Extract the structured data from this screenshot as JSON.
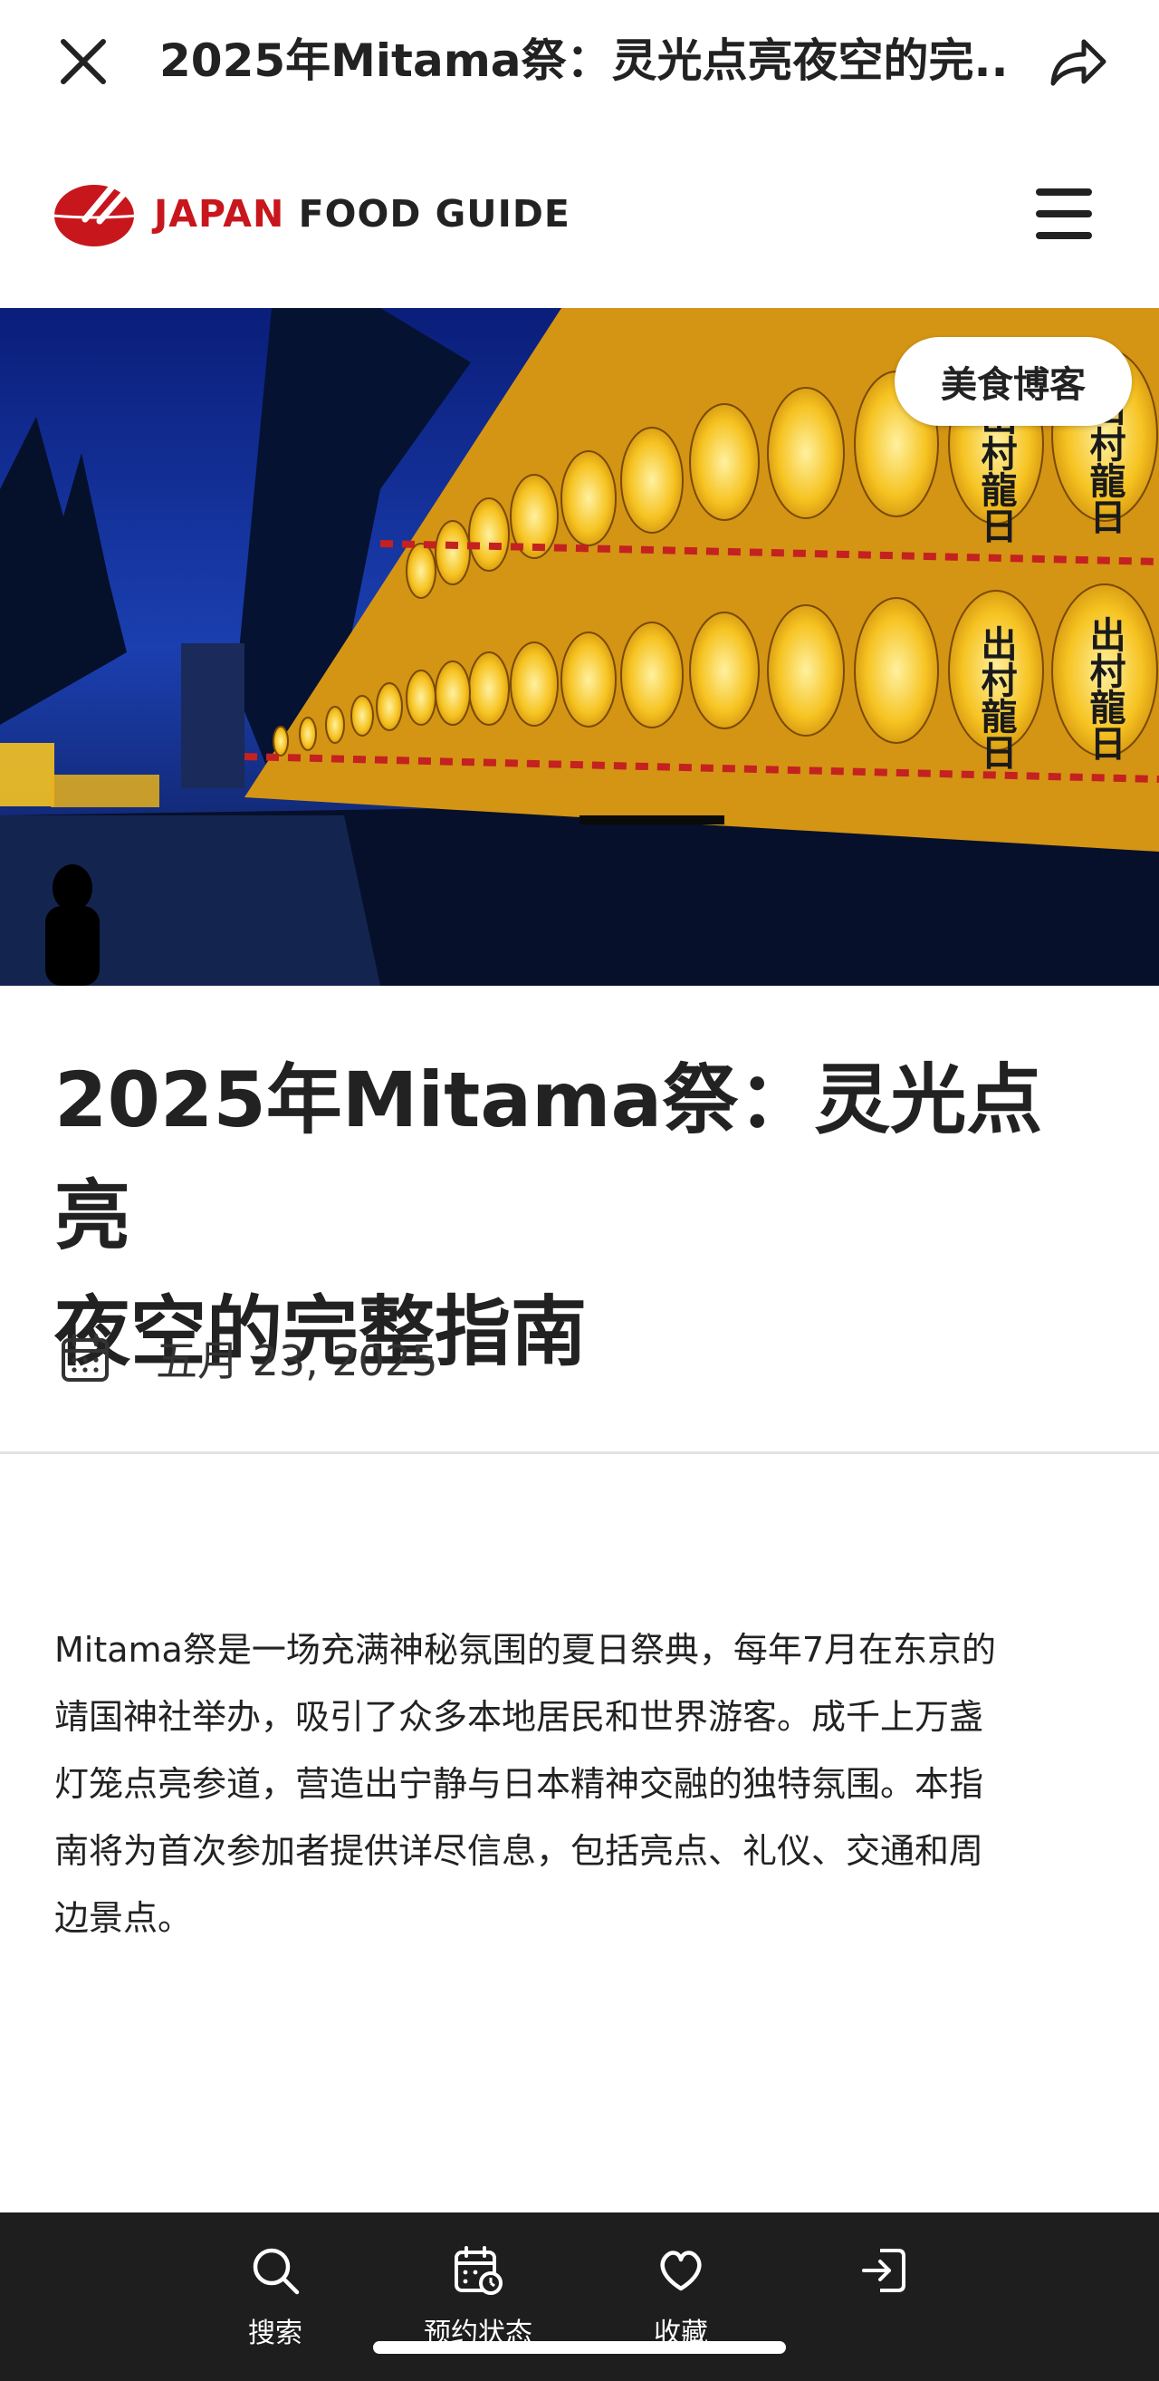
{
  "topbar": {
    "title": "2025年Mitama祭：灵光点亮夜空的完..."
  },
  "brand": {
    "name_red": "JAPAN",
    "name_dark": "FOOD GUIDE",
    "accent": "#c8161d"
  },
  "hero": {
    "category_tag": "美食博客",
    "lantern_texts": [
      "出村龍日",
      "出村龍日",
      "出村龍日",
      "出村龍日"
    ]
  },
  "article": {
    "title_line1": "2025年Mitama祭：灵光点亮",
    "title_line2": "夜空的完整指南",
    "date": "五月 23, 2025",
    "body_lines": [
      "Mitama祭是一场充满神秘氛围的夏日祭典，每年7月在东京的",
      "靖国神社举办，吸引了众多本地居民和世界游客。成千上万盏",
      "灯笼点亮参道，营造出宁静与日本精神交融的独特氛围。本指",
      "南将为首次参加者提供详尽信息，包括亮点、礼仪、交通和周",
      "边景点。"
    ]
  },
  "bottom_nav": {
    "items": [
      {
        "label": "搜索",
        "icon": "search-icon"
      },
      {
        "label": "预约状态",
        "icon": "calendar-clock-icon"
      },
      {
        "label": "收藏",
        "icon": "heart-icon"
      },
      {
        "label": "",
        "icon": "login-icon"
      }
    ]
  }
}
